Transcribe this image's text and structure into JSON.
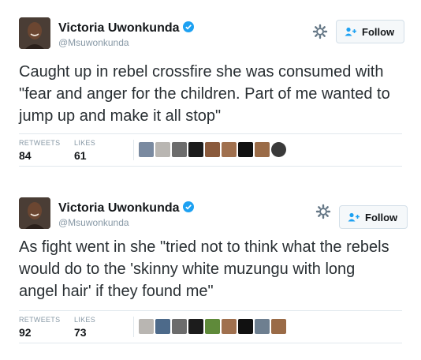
{
  "tweets": [
    {
      "author": {
        "name": "Victoria Uwonkunda",
        "handle": "@Msuwonkunda"
      },
      "follow_label": "Follow",
      "text": "Caught up in rebel crossfire she was consumed with \"fear and anger for the children. Part of me wanted to jump up and make it all stop\"",
      "retweets_label": "RETWEETS",
      "retweets": "84",
      "likes_label": "LIKES",
      "likes": "61"
    },
    {
      "author": {
        "name": "Victoria Uwonkunda",
        "handle": "@Msuwonkunda"
      },
      "follow_label": "Follow",
      "text": "As fight went in she \"tried not to think what the rebels would do to the 'skinny white muzungu with long angel hair' if they found me\"",
      "retweets_label": "RETWEETS",
      "retweets": "92",
      "likes_label": "LIKES",
      "likes": "73"
    }
  ],
  "colors": {
    "verified": "#1da1f2",
    "follow_icon": "#1da1f2",
    "muted": "#8899a6"
  }
}
